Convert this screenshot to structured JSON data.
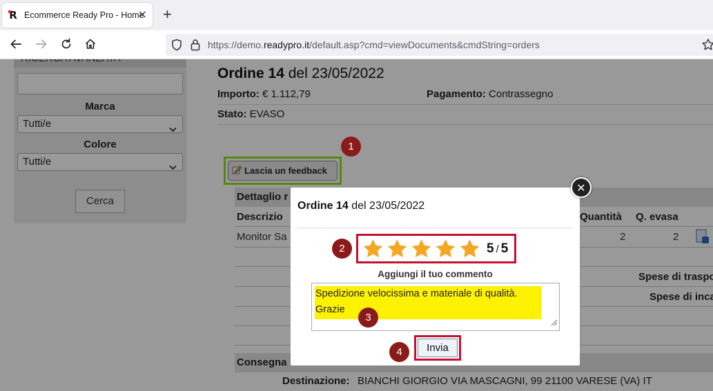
{
  "browser": {
    "tab_title": "Ecommerce Ready Pro - Home",
    "tab_close": "×",
    "new_tab": "+",
    "url_prefix": "https://demo.",
    "url_domain": "readypro.it",
    "url_rest": "/default.asp?cmd=viewDocuments&cmdString=orders"
  },
  "sidebar": {
    "heading": "RICERCA AVANZATA",
    "marca_label": "Marca",
    "marca_value": "Tutti/e",
    "colore_label": "Colore",
    "colore_value": "Tutti/e",
    "search_button": "Cerca"
  },
  "order": {
    "title_bold": "Ordine 14",
    "title_date": " del 23/05/2022",
    "importo_label": "Importo:",
    "importo_value": " € 1.112,79",
    "pagamento_label": "Pagamento:",
    "pagamento_value": " Contrassegno",
    "stato_label": "Stato:",
    "stato_value": " EVASO",
    "feedback_button": "Lascia un feedback",
    "detail_heading": "Dettaglio r",
    "col_descrizione": "Descrizio",
    "col_quantita": "Quantità",
    "col_qevasa": "Q. evasa",
    "row_product": "Monitor Sa",
    "row_qty": "2",
    "row_qevasa": "2",
    "spese_trasporto": "Spese di traspo",
    "spese_incasso": "Spese di inca",
    "consegna_heading": "Consegna",
    "destinazione_label": "Destinazione:",
    "destinazione_value": "BIANCHI GIORGIO VIA MASCAGNI, 99 21100 VARESE (VA) IT"
  },
  "modal": {
    "title_bold": "Ordine 14",
    "title_date": " del 23/05/2022",
    "rating": 5,
    "rating_max": 5,
    "score_value": "5",
    "score_slash": "/",
    "score_max": "5",
    "comment_label": "Aggiungi il tuo commento",
    "comment_line1": "Spedizione velocissima e materiale di qualità.",
    "comment_line2": "Grazie",
    "submit_button": "Invia",
    "close_symbol": "✕"
  },
  "markers": [
    "1",
    "2",
    "3",
    "4"
  ],
  "colors": {
    "highlight_green": "#8ee01b",
    "highlight_red": "#c8102e",
    "marker": "#8b1a1a",
    "star": "#f5a623",
    "comment_highlight": "#fff200"
  }
}
